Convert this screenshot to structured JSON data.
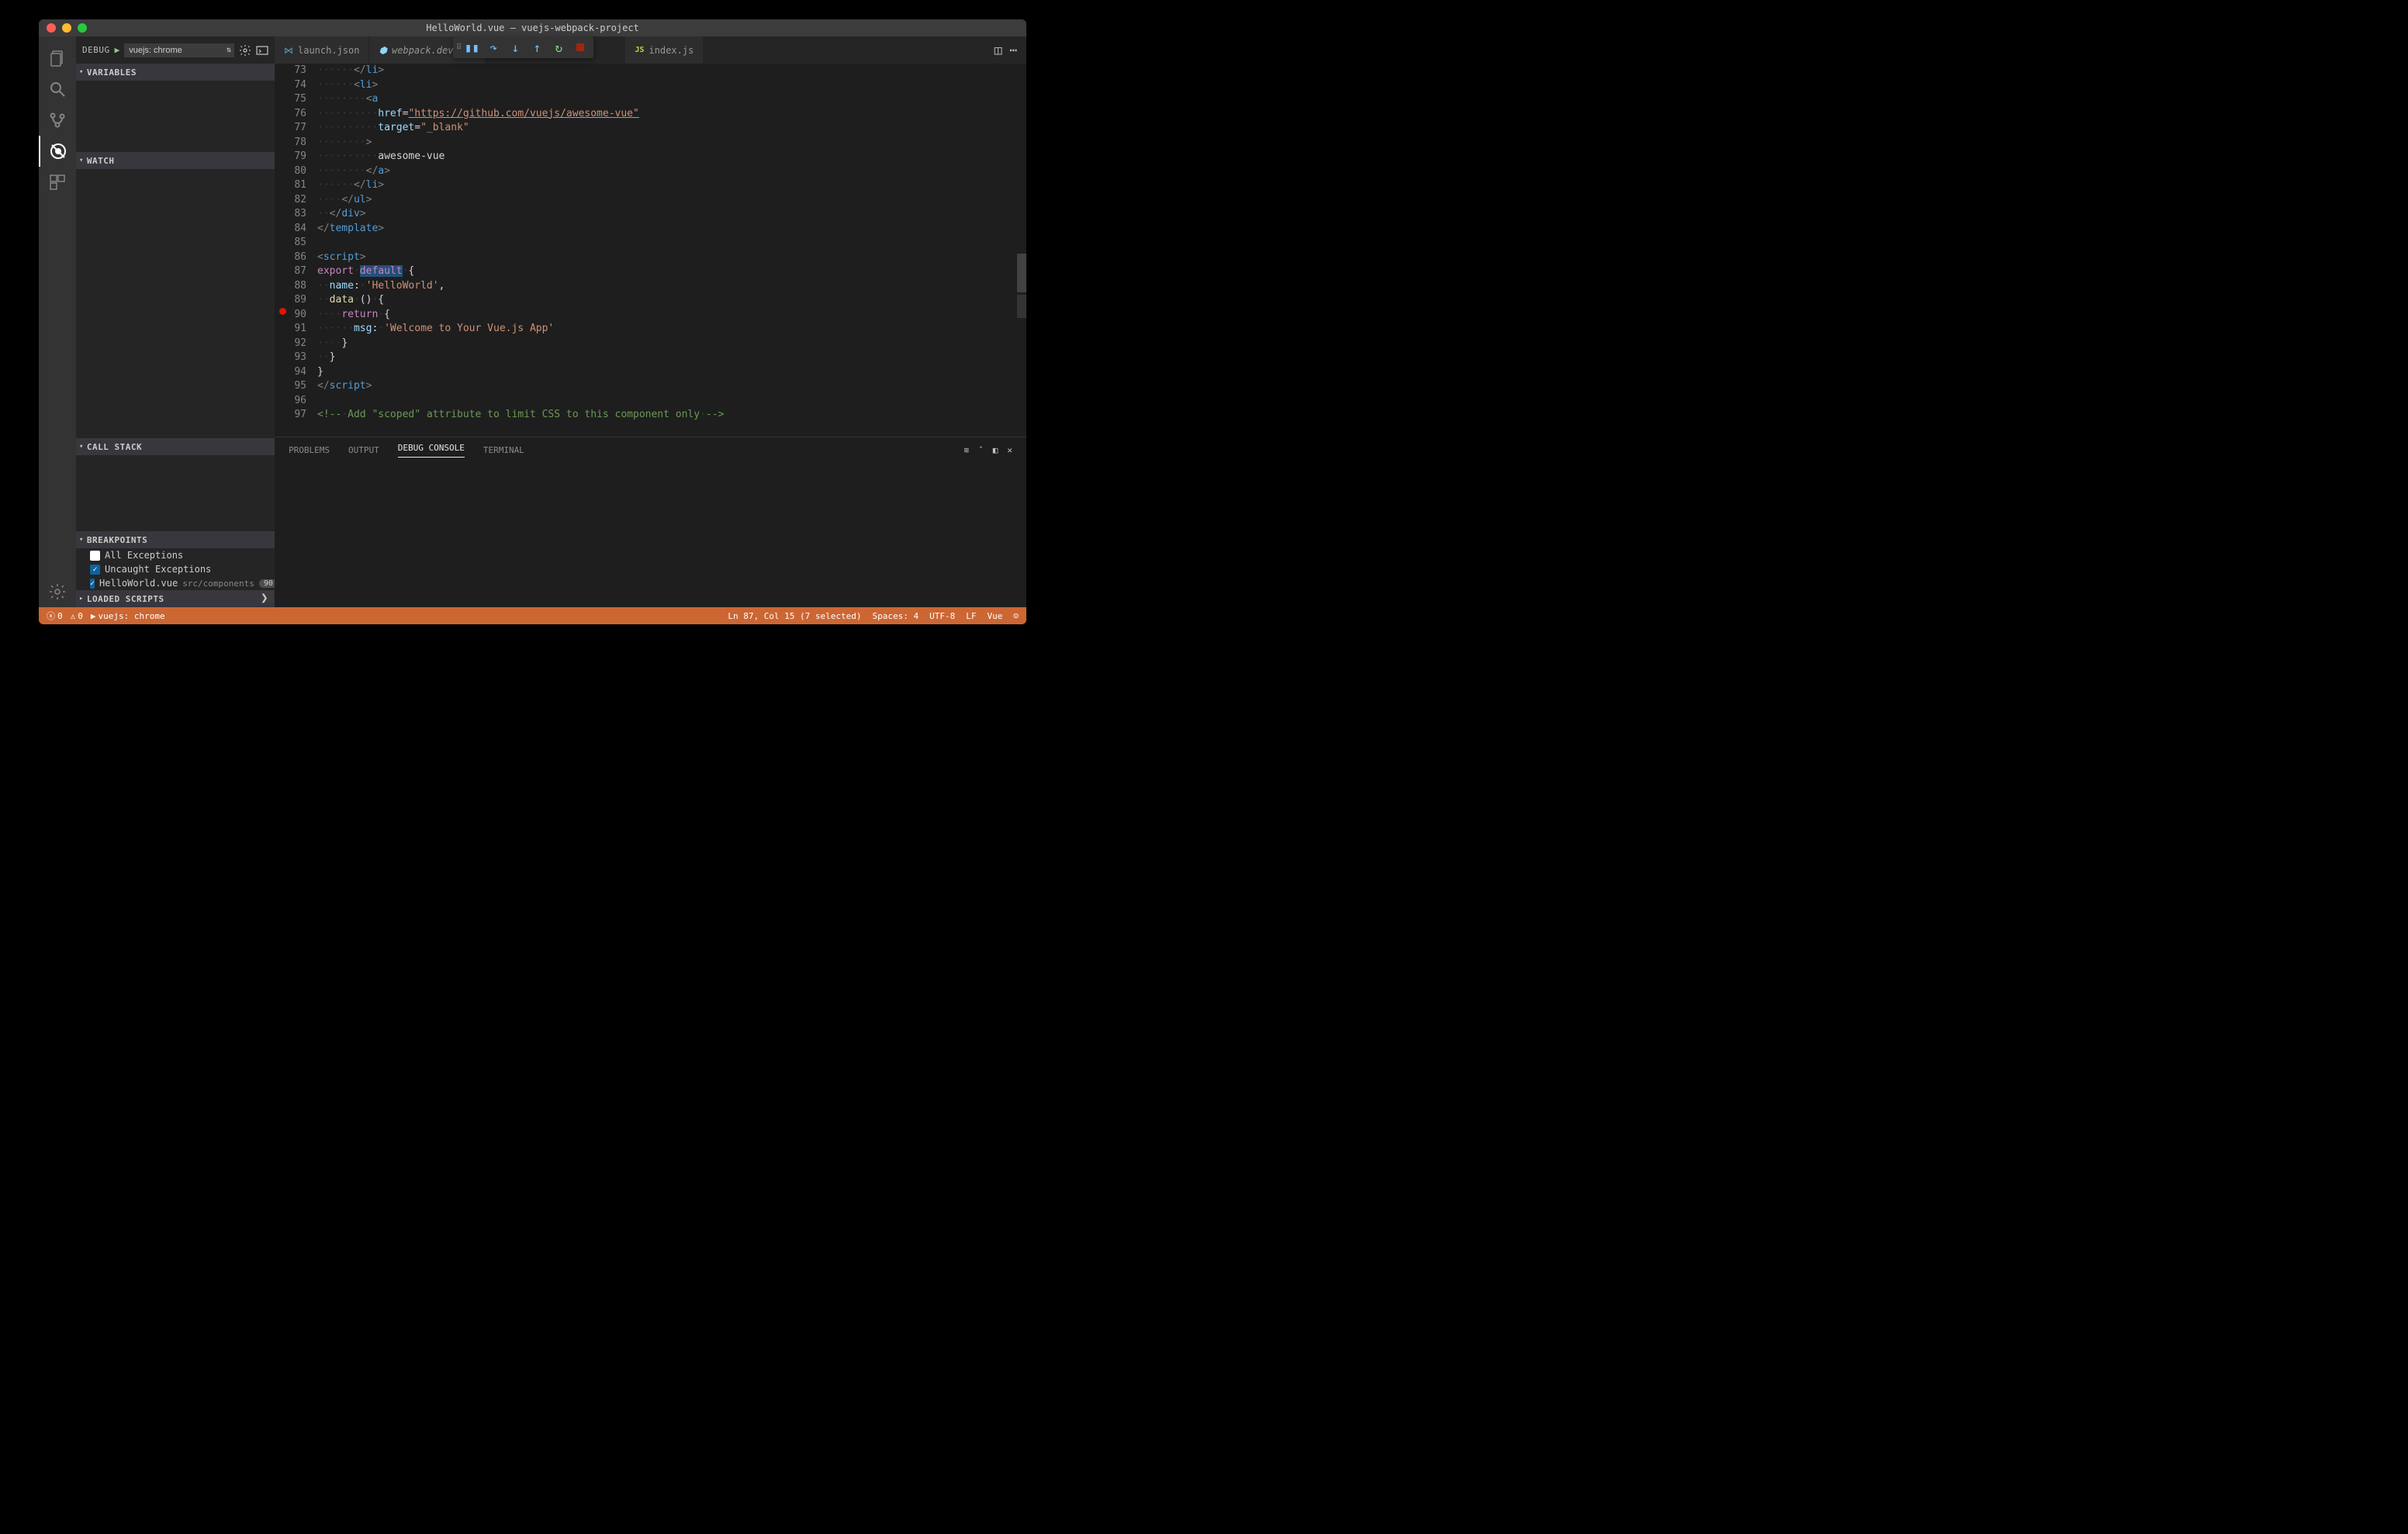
{
  "title": "HelloWorld.vue — vuejs-webpack-project",
  "debug": {
    "label": "DEBUG",
    "config": "vuejs: chrome"
  },
  "sections": {
    "variables": "VARIABLES",
    "watch": "WATCH",
    "callstack": "CALL STACK",
    "breakpoints": "BREAKPOINTS",
    "loaded": "LOADED SCRIPTS"
  },
  "breakpoints": {
    "all": "All Exceptions",
    "uncaught": "Uncaught Exceptions",
    "file": "HelloWorld.vue",
    "filepath": "src/components",
    "line": "90"
  },
  "tabs": {
    "t1": "launch.json",
    "t2": "webpack.dev.con",
    "t3": "JS",
    "t3name": "index.js"
  },
  "panel": {
    "problems": "PROBLEMS",
    "output": "OUTPUT",
    "debugconsole": "DEBUG CONSOLE",
    "terminal": "TERMINAL"
  },
  "status": {
    "errors": "0",
    "warnings": "0",
    "launch": "vuejs: chrome",
    "selection": "Ln 87, Col 15 (7 selected)",
    "spaces": "Spaces: 4",
    "encoding": "UTF-8",
    "eol": "LF",
    "lang": "Vue"
  },
  "lines": [
    73,
    74,
    75,
    76,
    77,
    78,
    79,
    80,
    81,
    82,
    83,
    84,
    85,
    86,
    87,
    88,
    89,
    90,
    91,
    92,
    93,
    94,
    95,
    96,
    97
  ],
  "code": {
    "l76_href": "\"https://github.com/vuejs/awesome-vue\"",
    "l77_target": "\"_blank\"",
    "l79_text": "awesome-vue",
    "l88_name": "'HelloWorld'",
    "l91_msg": "'Welcome to Your Vue.js App'",
    "l97_comment": "Add \"scoped\" attribute to limit CSS to this component only"
  }
}
